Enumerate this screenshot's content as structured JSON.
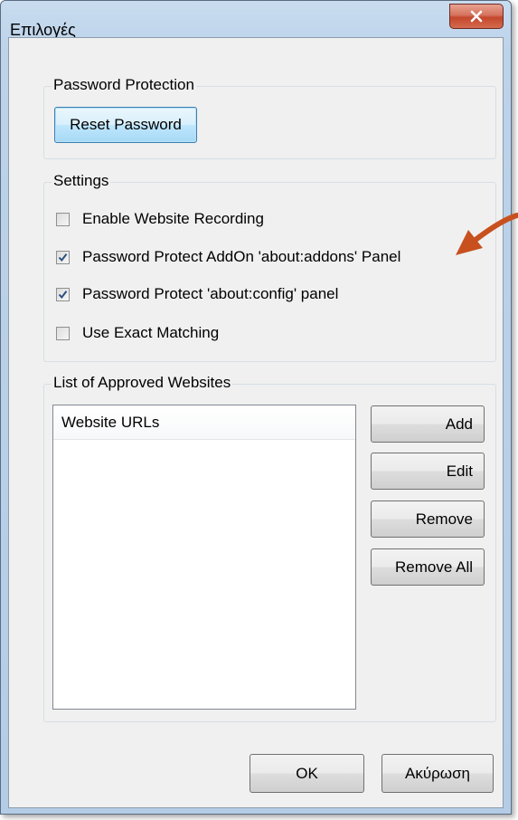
{
  "window": {
    "title": "Επιλογές",
    "close_label": "x"
  },
  "password_protection": {
    "group_label": "Password Protection",
    "reset_button": "Reset Password"
  },
  "settings": {
    "group_label": "Settings",
    "options": [
      {
        "label": "Enable Website Recording",
        "checked": false
      },
      {
        "label": "Password Protect AddOn 'about:addons' Panel",
        "checked": true
      },
      {
        "label": "Password Protect 'about:config' panel",
        "checked": true
      },
      {
        "label": "Use Exact Matching",
        "checked": false
      }
    ]
  },
  "approved_websites": {
    "group_label": "List of Approved Websites",
    "column_header": "Website URLs",
    "rows": [],
    "buttons": {
      "add": "Add",
      "edit": "Edit",
      "remove": "Remove",
      "remove_all": "Remove All"
    }
  },
  "footer": {
    "ok": "OK",
    "cancel": "Ακύρωση"
  },
  "annotation": {
    "icon": "arrow-pointer-icon",
    "color": "#c8501e"
  }
}
